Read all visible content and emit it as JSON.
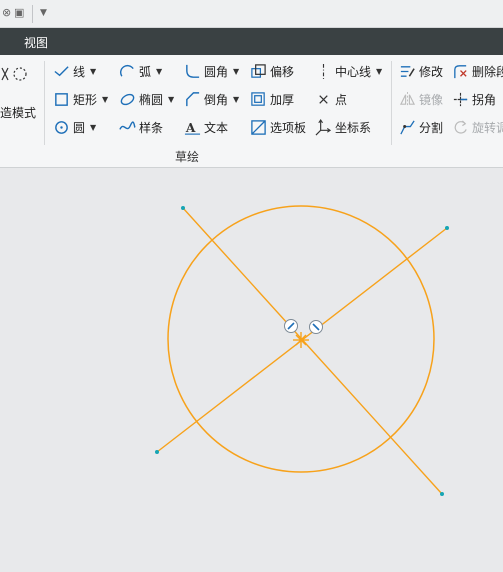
{
  "menubar": {
    "tab_view": "视图"
  },
  "ribbon": {
    "mode_label": "造模式",
    "line": "线",
    "rectangle": "矩形",
    "circle": "圆",
    "arc": "弧",
    "ellipse": "椭圆",
    "spline": "样条",
    "fillet": "圆角",
    "chamfer": "倒角",
    "text": "文本",
    "offset": "偏移",
    "thicken": "加厚",
    "palette": "选项板",
    "centerline": "中心线",
    "point": "点",
    "coordinate_system": "坐标系",
    "modify": "修改",
    "delete_segment": "删除段",
    "mirror": "镜像",
    "corner": "拐角",
    "divide": "分割",
    "rotate_resize": "旋转调",
    "group_label": "草绘"
  },
  "colors": {
    "sketch_entity": "#f7a21b",
    "endpoint": "#17a5b4",
    "menubar_bg": "#3a4143"
  }
}
